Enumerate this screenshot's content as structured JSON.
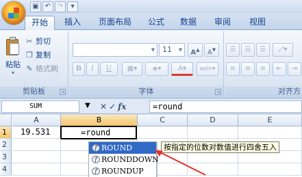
{
  "qat": {
    "save_icon": "save-icon",
    "undo_icon": "undo-icon",
    "redo_icon": "redo-icon"
  },
  "tabs": [
    {
      "label": "开始",
      "active": true
    },
    {
      "label": "插入"
    },
    {
      "label": "页面布局"
    },
    {
      "label": "公式"
    },
    {
      "label": "数据"
    },
    {
      "label": "审阅"
    },
    {
      "label": "视图"
    }
  ],
  "clipboard": {
    "paste_label": "粘贴",
    "cut_label": "剪切",
    "copy_label": "复制",
    "format_painter_label": "格式刷",
    "group_label": "剪贴板"
  },
  "font": {
    "font_name": "",
    "font_size": "11",
    "grow_label": "A",
    "shrink_label": "A",
    "bold": "B",
    "italic": "I",
    "underline": "U",
    "font_color_label": "A",
    "phonetic_label": "wén",
    "group_label": "字体"
  },
  "alignment": {
    "group_label": "对齐方"
  },
  "formula_bar": {
    "name_box": "SUM",
    "cancel_icon": "✕",
    "enter_icon": "✓",
    "fx_label": "fx",
    "formula": "=round"
  },
  "grid": {
    "columns": [
      "A",
      "B",
      "C",
      "D",
      "E"
    ],
    "rows": [
      "1",
      "2",
      "3",
      "4"
    ],
    "cells": {
      "A1": "19.531",
      "B1": "=round"
    },
    "selected_cell": "B1"
  },
  "autocomplete": {
    "items": [
      "ROUND",
      "ROUNDDOWN",
      "ROUNDUP"
    ],
    "selected_index": 0,
    "tooltip": "按指定的位数对数值进行四舍五入"
  },
  "colors": {
    "accent": "#3169c6",
    "annotation_arrow": "#e5322d",
    "ribbon": "#dbe5f1"
  }
}
